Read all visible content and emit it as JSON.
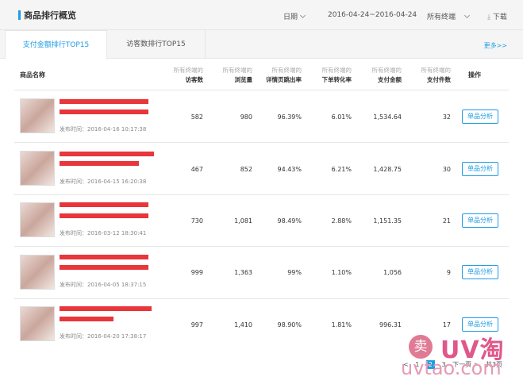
{
  "header": {
    "title": "商品排行概览",
    "date_label": "日期",
    "date_range": "2016-04-24~2016-04-24",
    "terminal_label": "所有终端",
    "download_label": "下载"
  },
  "tabs": [
    {
      "label": "支付金额排行TOP15",
      "active": true
    },
    {
      "label": "访客数排行TOP15",
      "active": false
    }
  ],
  "more_label": "更多>>",
  "columns": {
    "name": "商品名称",
    "prefix": "所有终端的",
    "metrics": [
      "访客数",
      "浏览量",
      "详情页跳出率",
      "下单转化率",
      "支付金额",
      "支付件数"
    ],
    "operation": "操作"
  },
  "rows": [
    {
      "time": "发布时间：2016-04-16 10:17:38",
      "values": [
        "582",
        "980",
        "96.39%",
        "6.01%",
        "1,534.64",
        "32"
      ],
      "action": "单品分析"
    },
    {
      "time": "发布时间：2016-04-15 16:20:38",
      "values": [
        "467",
        "852",
        "94.43%",
        "6.21%",
        "1,428.75",
        "30"
      ],
      "action": "单品分析"
    },
    {
      "time": "发布时间：2016-03-12 18:30:41",
      "values": [
        "730",
        "1,081",
        "98.49%",
        "2.88%",
        "1,151.35",
        "21"
      ],
      "action": "单品分析"
    },
    {
      "time": "发布时间：2016-04-05 18:37:15",
      "values": [
        "999",
        "1,363",
        "99%",
        "1.10%",
        "1,056",
        "9"
      ],
      "action": "单品分析"
    },
    {
      "time": "发布时间：2016-04-20 17:38:17",
      "values": [
        "997",
        "1,410",
        "98.90%",
        "1.81%",
        "996.31",
        "17"
      ],
      "action": "单品分析"
    }
  ],
  "pager": {
    "prev": "<",
    "pages": [
      "1",
      "2",
      "3"
    ],
    "current": "2",
    "next": "下一页 >",
    "total": "共3页"
  },
  "watermark": {
    "seal": "卖",
    "brand": "UV淘",
    "url": "uvtao.com"
  },
  "colors": {
    "accent": "#1e9ce5",
    "redaction": "#e8363b"
  }
}
